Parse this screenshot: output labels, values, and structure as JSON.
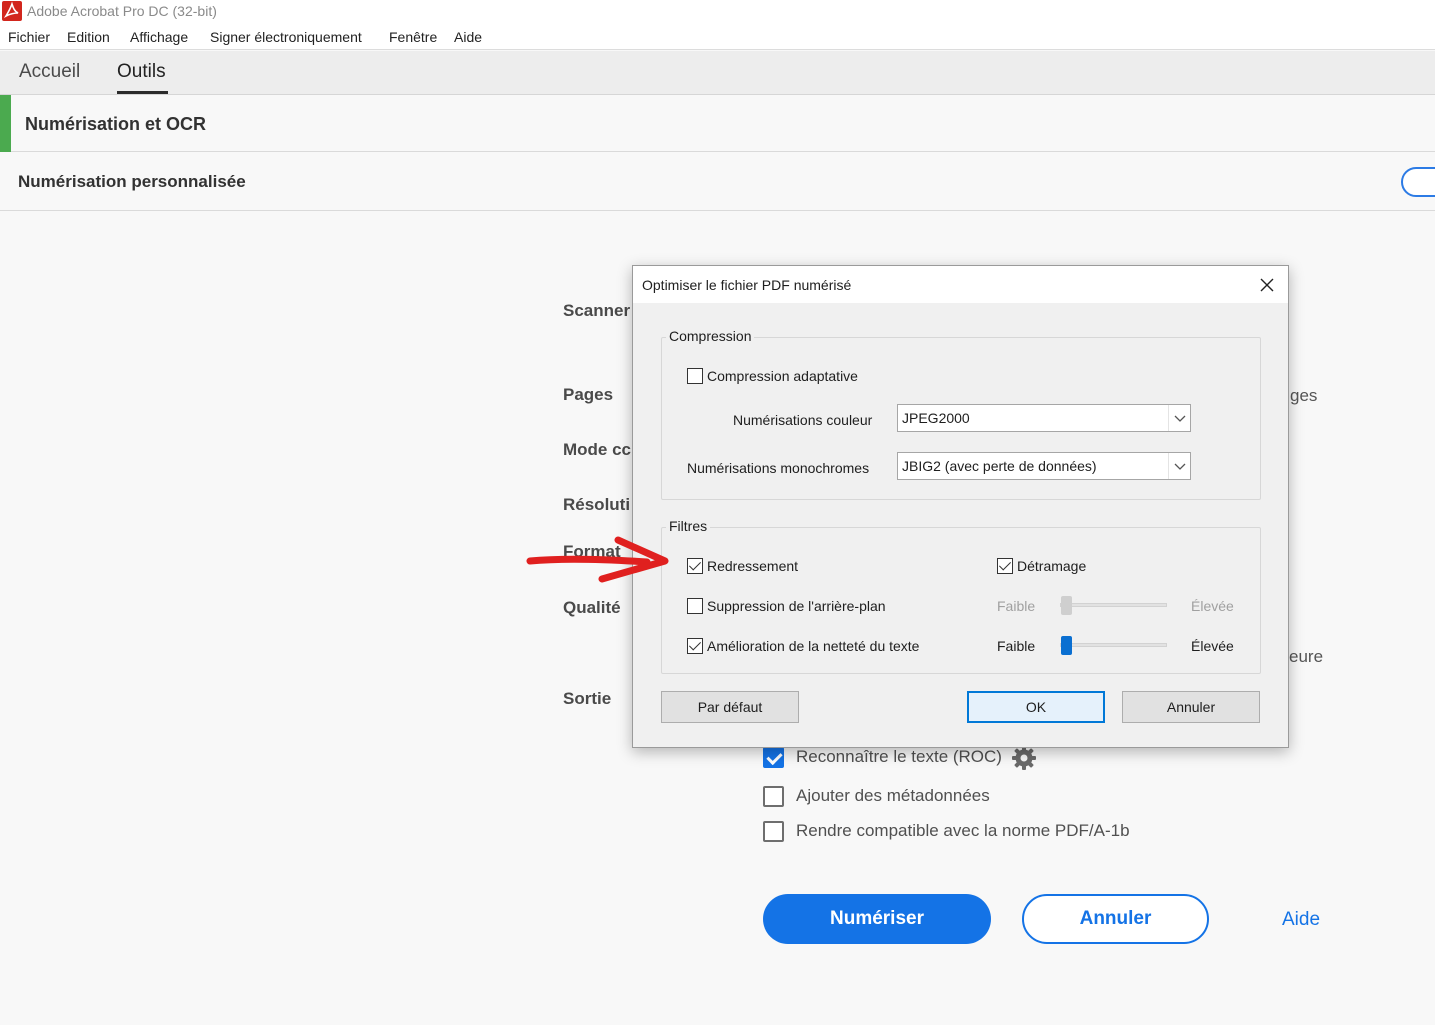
{
  "app": {
    "title": "Adobe Acrobat Pro DC (32-bit)"
  },
  "menu": [
    "Fichier",
    "Edition",
    "Affichage",
    "Signer électroniquement",
    "Fenêtre",
    "Aide"
  ],
  "tabs": [
    "Accueil",
    "Outils"
  ],
  "active_tab": "Outils",
  "tool": {
    "title": "Numérisation et OCR",
    "subtitle": "Numérisation personnalisée"
  },
  "form_labels": {
    "scanner": "Scanner",
    "pages": "Pages",
    "mode": "Mode cc",
    "resolution": "Résoluti",
    "format": "Format",
    "quality": "Qualité",
    "output": "Sortie"
  },
  "side_fragments": {
    "pages": "ges",
    "quality": "eure"
  },
  "options": [
    {
      "label": "Reconnaître le texte (ROC)",
      "checked": true
    },
    {
      "label": "Ajouter des métadonnées",
      "checked": false
    },
    {
      "label": "Rendre compatible avec la norme PDF/A-1b",
      "checked": false
    }
  ],
  "actions": {
    "scan": "Numériser",
    "cancel": "Annuler",
    "help": "Aide"
  },
  "dialog": {
    "title": "Optimiser le fichier PDF numérisé",
    "compression": {
      "legend": "Compression",
      "adaptive": {
        "label": "Compression adaptative",
        "checked": false
      },
      "color_label": "Numérisations couleur",
      "color_value": "JPEG2000",
      "mono_label": "Numérisations monochromes",
      "mono_value": "JBIG2 (avec perte de données)"
    },
    "filters": {
      "legend": "Filtres",
      "deskew": {
        "label": "Redressement",
        "checked": true
      },
      "descreen": {
        "label": "Détramage",
        "checked": true
      },
      "background": {
        "label": "Suppression de l'arrière-plan",
        "checked": false,
        "low": "Faible",
        "high": "Élevée",
        "level": 0,
        "enabled": false
      },
      "sharpen": {
        "label": "Amélioration de la netteté du texte",
        "checked": true,
        "low": "Faible",
        "high": "Élevée",
        "level": 0,
        "enabled": true
      }
    },
    "buttons": {
      "default": "Par défaut",
      "ok": "OK",
      "cancel": "Annuler"
    }
  },
  "colors": {
    "accent": "#1473e6",
    "tool_accent": "#4baa4f",
    "arrow": "#e0201f",
    "focus": "#0078d7"
  }
}
